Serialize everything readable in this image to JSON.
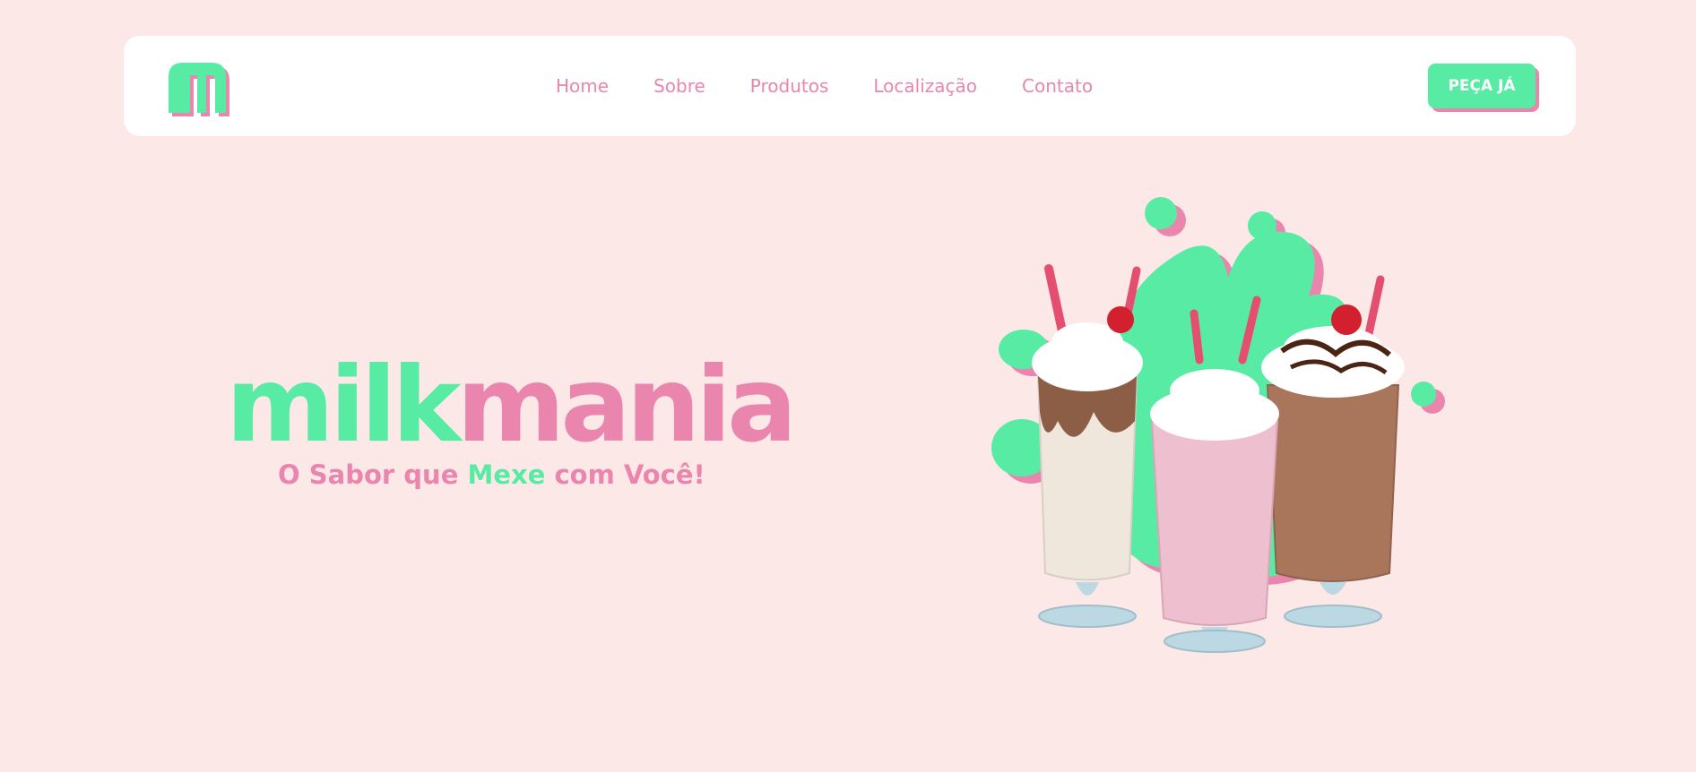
{
  "colors": {
    "background": "#fde8e8",
    "accent_green": "#58eba3",
    "accent_pink": "#ea86ad",
    "navbar": "#ffffff"
  },
  "navbar": {
    "logo_icon": "milkmania-m-logo-icon",
    "links": [
      {
        "label": "Home"
      },
      {
        "label": "Sobre"
      },
      {
        "label": "Produtos"
      },
      {
        "label": "Localização"
      },
      {
        "label": "Contato"
      }
    ],
    "cta_label": "PEÇA JÁ"
  },
  "hero": {
    "brand_part1": "milk",
    "brand_part2": "mania",
    "tagline_part1": "O Sabor que ",
    "tagline_highlight": "Mexe",
    "tagline_part2": " com Você!",
    "image_icon": "milkshakes-illustration-icon"
  }
}
